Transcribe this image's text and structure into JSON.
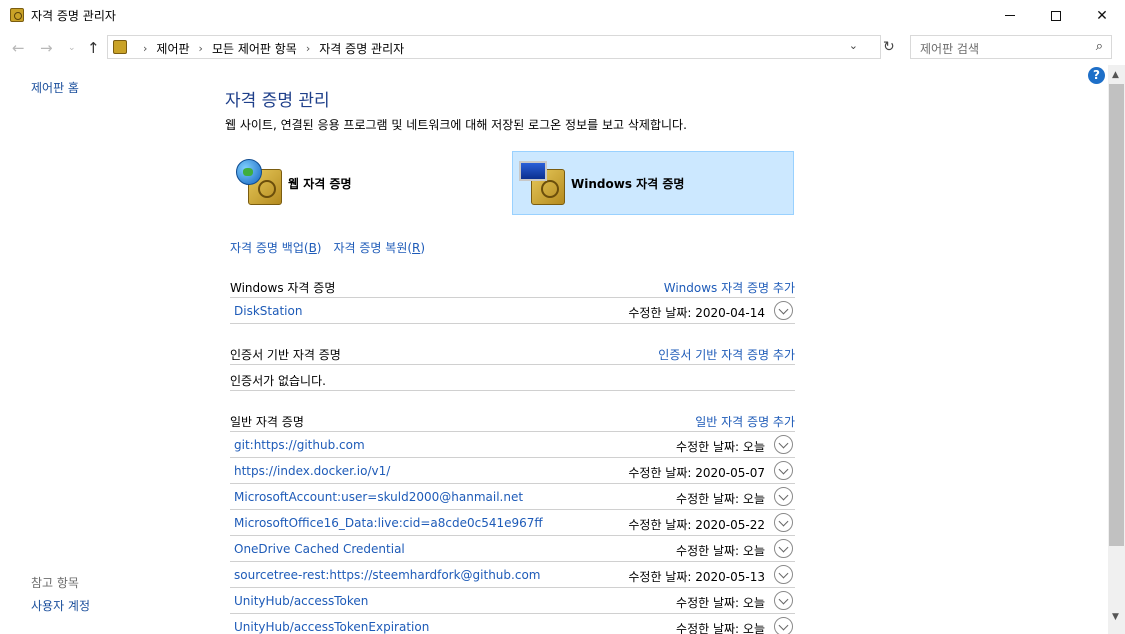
{
  "window": {
    "title": "자격 증명 관리자",
    "minimize": "minimize",
    "maximize": "maximize",
    "close": "✕"
  },
  "address": {
    "crumbs": [
      "제어판",
      "모든 제어판 항목",
      "자격 증명 관리자"
    ],
    "search_placeholder": "제어판 검색"
  },
  "leftnav": {
    "home": "제어판 홈",
    "see_also": "참고 항목",
    "user_accounts": "사용자 계정"
  },
  "main": {
    "title": "자격 증명 관리",
    "description": "웹 사이트, 연결된 응용 프로그램 및 네트워크에 대해 저장된 로그온 정보를 보고 삭제합니다.",
    "web_tile": "웹 자격 증명",
    "windows_tile": "Windows 자격 증명",
    "backup_link": "자격 증명 백업",
    "backup_key": "B",
    "restore_link": "자격 증명 복원",
    "restore_key": "R"
  },
  "sections": {
    "windows": {
      "title": "Windows 자격 증명",
      "add": "Windows 자격 증명 추가",
      "items": [
        {
          "name": "DiskStation",
          "date": "수정한 날짜:  2020-04-14"
        }
      ]
    },
    "cert": {
      "title": "인증서 기반 자격 증명",
      "add": "인증서 기반 자격 증명 추가",
      "empty": "인증서가 없습니다."
    },
    "general": {
      "title": "일반 자격 증명",
      "add": "일반 자격 증명 추가",
      "items": [
        {
          "name": "git:https://github.com",
          "date": "수정한 날짜:  오늘"
        },
        {
          "name": "https://index.docker.io/v1/",
          "date": "수정한 날짜:  2020-05-07"
        },
        {
          "name": "MicrosoftAccount:user=skuld2000@hanmail.net",
          "date": "수정한 날짜:  오늘"
        },
        {
          "name": "MicrosoftOffice16_Data:live:cid=a8cde0c541e967ff",
          "date": "수정한 날짜:  2020-05-22"
        },
        {
          "name": "OneDrive Cached Credential",
          "date": "수정한 날짜:  오늘"
        },
        {
          "name": "sourcetree-rest:https://steemhardfork@github.com",
          "date": "수정한 날짜:  2020-05-13"
        },
        {
          "name": "UnityHub/accessToken",
          "date": "수정한 날짜:  오늘"
        },
        {
          "name": "UnityHub/accessTokenExpiration",
          "date": "수정한 날짜:  오늘"
        }
      ]
    }
  },
  "icons": {
    "window_icon": "credential-vault-icon",
    "help": "?",
    "back": "←",
    "forward": "→",
    "recent": "⌄",
    "up": "↑",
    "dropdown": "⌄",
    "refresh": "↻",
    "search": "⌕",
    "scroll_up": "▲",
    "scroll_down": "▼"
  }
}
